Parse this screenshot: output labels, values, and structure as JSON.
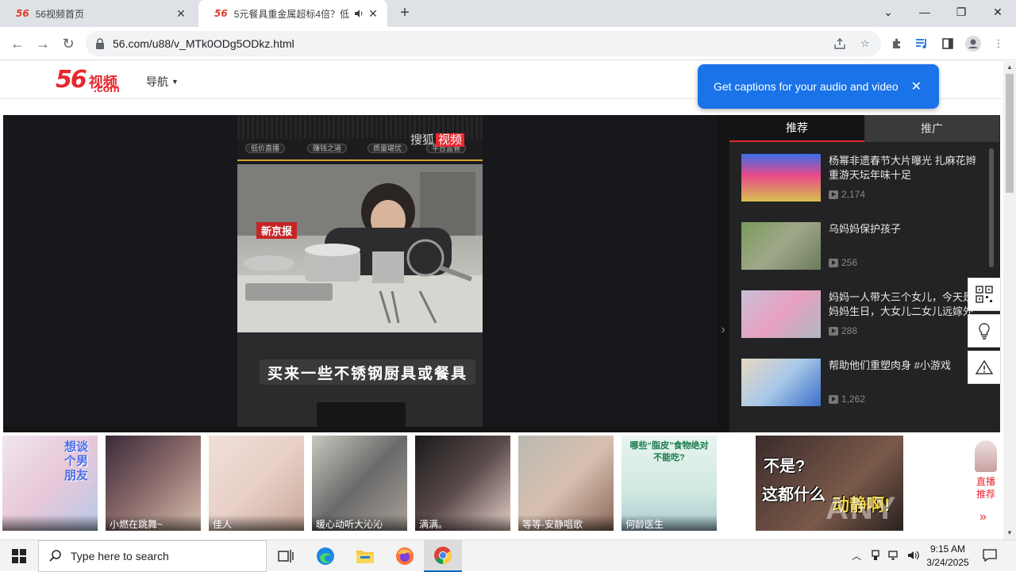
{
  "browser": {
    "tabs": [
      {
        "favicon": "56",
        "title": "56视频首页"
      },
      {
        "favicon": "56",
        "title": "5元餐具重金属超标4倍？低"
      }
    ],
    "url": "56.com/u88/v_MTk0ODg5ODkz.html",
    "new_tab_symbol": "+"
  },
  "site": {
    "logo_num": "56",
    "logo_cn": "视频",
    "logo_domain": ".com",
    "nav_label": "导航"
  },
  "caption_bubble": {
    "text": "Get captions for your audio and video"
  },
  "player": {
    "brand": "搜狐",
    "brand_red": "视频",
    "news_badge": "新京报",
    "tags": [
      "低价直播",
      "赚钱之道",
      "质量堪忧",
      "平台监管"
    ],
    "subtitle": "买来一些不锈钢厨具或餐具"
  },
  "side_panel": {
    "tabs": [
      "推荐",
      "推广"
    ],
    "items": [
      {
        "title": "杨幂非遗春节大片曝光 扎麻花辫重游天坛年味十足",
        "views": "2,174"
      },
      {
        "title": "乌妈妈保护孩子",
        "views": "256"
      },
      {
        "title": "妈妈一人带大三个女儿，今天是妈妈生日，大女儿二女儿远嫁外地,...",
        "views": "288"
      },
      {
        "title": "帮助他们重塑肉身 #小游戏",
        "views": "1,262"
      }
    ]
  },
  "strip": {
    "cards": [
      {
        "caption": ""
      },
      {
        "caption": "小燃在跳舞~"
      },
      {
        "caption": "佳人"
      },
      {
        "caption": "暖心动听大沁沁"
      },
      {
        "caption": "满满。"
      },
      {
        "caption": "等等-安静唱歌"
      },
      {
        "caption": "何龄医生"
      }
    ],
    "card1_overlay": "想谈个男朋友",
    "card7_overlay": "哪些“脂皮”食物绝对不能吃?",
    "ad_text_1": "不是?",
    "ad_text_2": "这都什么",
    "ad_text_3": "动静啊!",
    "live_rec_label": "直播推荐",
    "live_rec_arrow": "»",
    "watermark": "ANY RUN"
  },
  "taskbar": {
    "search_placeholder": "Type here to search",
    "time": "9:15 AM",
    "date": "3/24/2025"
  }
}
